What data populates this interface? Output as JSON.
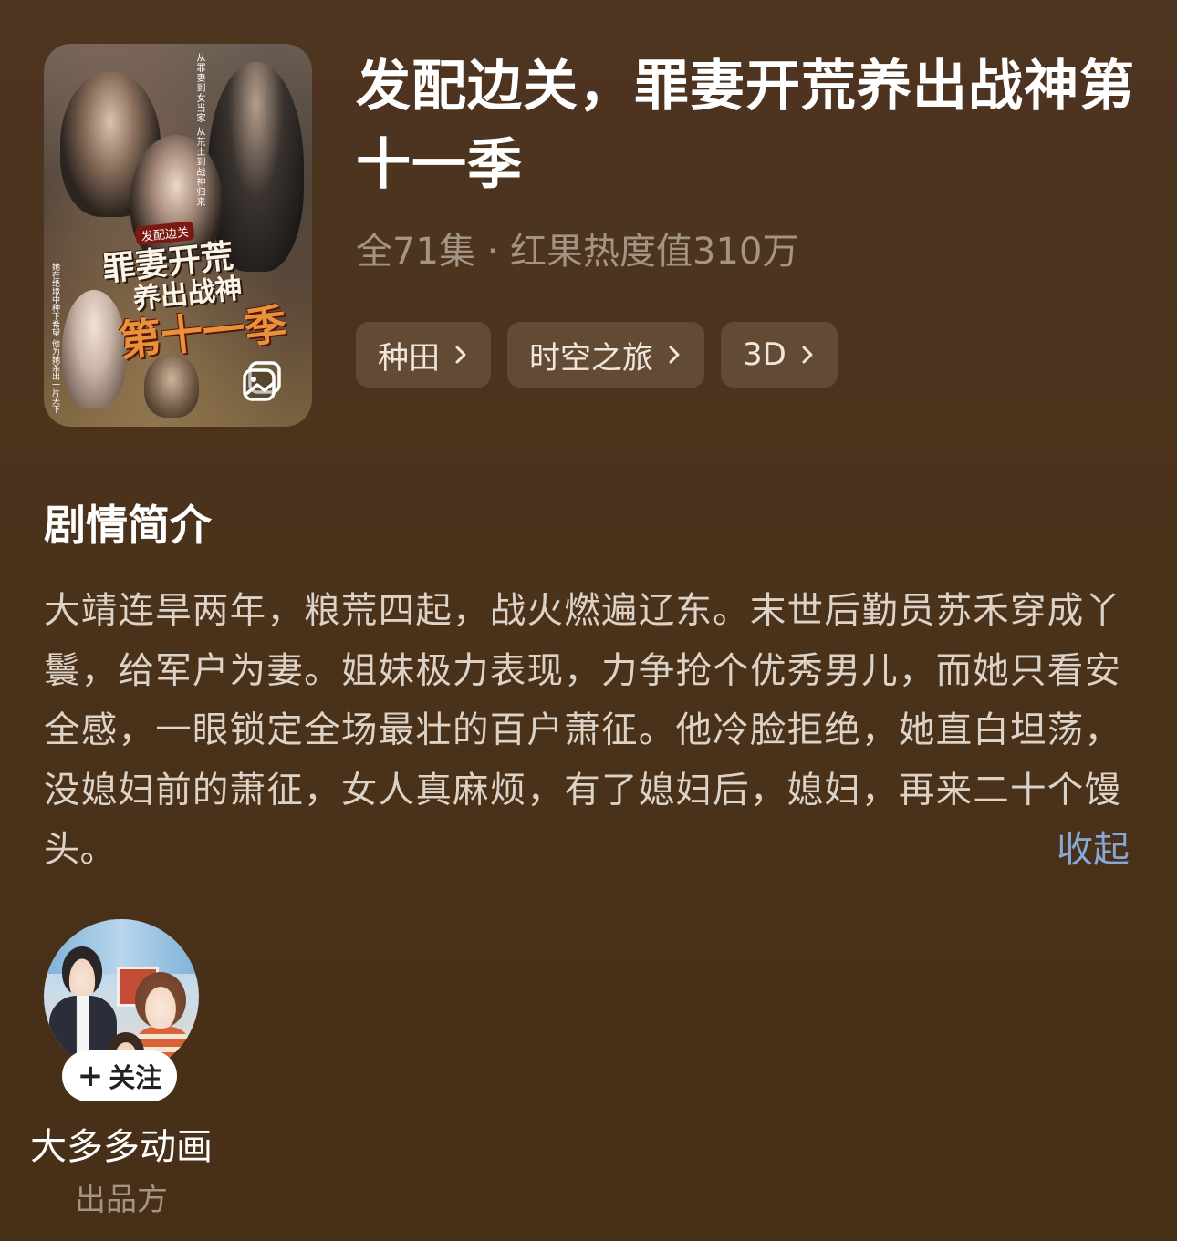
{
  "drama": {
    "title": "发配边关，罪妻开荒养出战神第十一季",
    "meta": "全71集 · 红果热度值310万",
    "tags": [
      {
        "label": "种田"
      },
      {
        "label": "时空之旅"
      },
      {
        "label": "3D"
      }
    ],
    "poster": {
      "small_title": "发配边关",
      "main_title": "罪妻开荒",
      "sub_title": "养出战神",
      "season": "第十一季",
      "vertical_text": "从罪妻到女当家 从荒土到战神归来",
      "vertical_text_2": "她在绝境中种下希望 他为她杀出一片天下"
    }
  },
  "synopsis": {
    "heading": "剧情简介",
    "text": "大靖连旱两年，粮荒四起，战火燃遍辽东。末世后勤员苏禾穿成丫鬟，给军户为妻。姐妹极力表现，力争抢个优秀男儿，而她只看安全感，一眼锁定全场最壮的百户萧征。他冷脸拒绝，她直白坦荡，没媳妇前的萧征，女人真麻烦，有了媳妇后，媳妇，再来二十个馒头。",
    "collapse_label": "收起"
  },
  "producer": {
    "name": "大多多动画",
    "role": "出品方",
    "follow_label": "关注",
    "follow_icon": "+"
  },
  "colors": {
    "background": "#4b321b",
    "tag_bg": "#624a35",
    "meta_text": "#a39484",
    "link": "#86a8d6"
  }
}
